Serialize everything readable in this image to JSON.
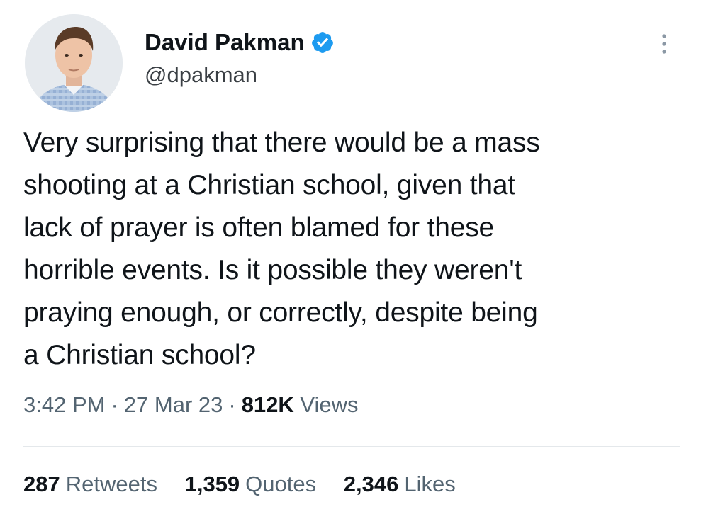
{
  "author": {
    "display_name": "David Pakman",
    "handle": "@dpakman",
    "verified": true
  },
  "tweet": {
    "text": "Very surprising that there would be a mass\nshooting at a Christian school, given that\nlack of prayer is often blamed for these\nhorrible events. Is it possible they weren't\npraying enough, or correctly, despite being\na Christian school?",
    "time": "3:42 PM",
    "date": "27 Mar 23",
    "separator": "·",
    "views_count": "812K",
    "views_label": "Views"
  },
  "stats": {
    "retweets_count": "287",
    "retweets_label": "Retweets",
    "quotes_count": "1,359",
    "quotes_label": "Quotes",
    "likes_count": "2,346",
    "likes_label": "Likes"
  },
  "icons": {
    "verified": "verified-badge-icon",
    "more": "more-options-icon"
  },
  "colors": {
    "verified_blue": "#1d9bf0",
    "secondary_text": "#536471",
    "primary_text": "#0f1419"
  }
}
